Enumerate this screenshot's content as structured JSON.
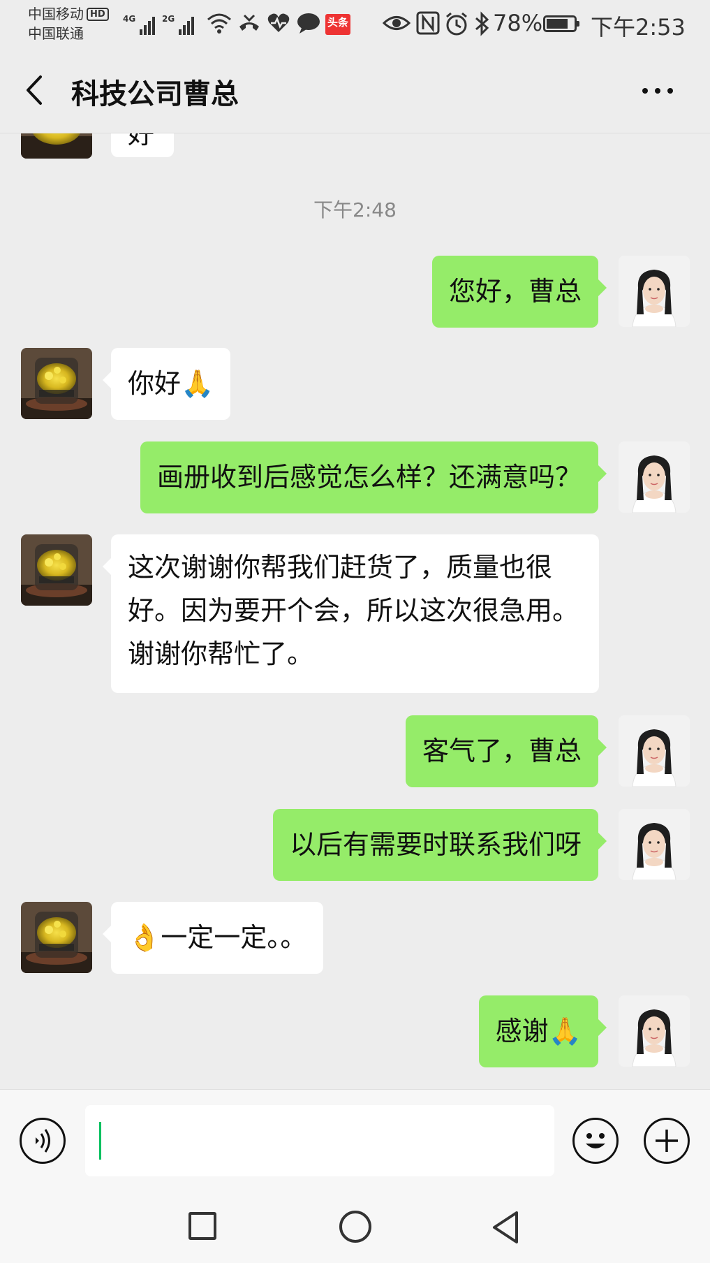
{
  "status_bar": {
    "carrier_1": "中国移动",
    "hd_badge": "HD",
    "carrier_2": "中国联通",
    "network_1": "4G",
    "network_2": "2G",
    "toutiao_label": "头条",
    "battery_percent": "78%",
    "battery_level": 0.78,
    "time": "下午2:53"
  },
  "header": {
    "title": "科技公司曹总",
    "back_icon": "chevron-left-icon",
    "more_icon": "more-icon"
  },
  "messages": {
    "partial_top": {
      "sender": "them",
      "text": "好"
    },
    "timestamp": "下午2:48",
    "m1": {
      "sender": "me",
      "text": "您好，曹总"
    },
    "m2": {
      "sender": "them",
      "text": "你好🙏"
    },
    "m3": {
      "sender": "me",
      "text": "画册收到后感觉怎么样？还满意吗？"
    },
    "m4": {
      "sender": "them",
      "text": "这次谢谢你帮我们赶货了，质量也很好。因为要开个会，所以这次很急用。谢谢你帮忙了。"
    },
    "m5": {
      "sender": "me",
      "text": "客气了，曹总"
    },
    "m6": {
      "sender": "me",
      "text": "以后有需要时联系我们呀"
    },
    "m7": {
      "sender": "them",
      "text": "👌一定一定。。"
    },
    "m8": {
      "sender": "me",
      "text": "感谢🙏"
    }
  },
  "input_bar": {
    "voice_icon": "voice-icon",
    "input_value": "",
    "emoji_icon": "emoji-icon",
    "plus_icon": "plus-icon"
  },
  "colors": {
    "background": "#ededed",
    "green_bubble": "#95ec69",
    "white_bubble": "#ffffff",
    "caret": "#07c160"
  }
}
